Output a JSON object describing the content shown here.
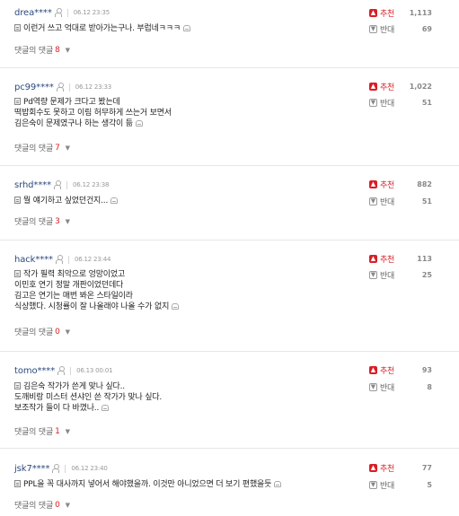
{
  "labels": {
    "up": "추천",
    "down": "반대",
    "replies": "댓글의 댓글"
  },
  "colors": {
    "accent": "#d81f26",
    "user": "#2e4a7d"
  },
  "icons": {
    "memo": "memo-icon",
    "report": "report-icon",
    "profile": "profile-icon",
    "up": "thumb-up-icon",
    "down": "thumb-down-icon",
    "chevron": "chevron-down-icon"
  },
  "comments": [
    {
      "user": "drea****",
      "time": "06.12 23:35",
      "lines": [
        "이런거 쓰고 억대로 받아가는구나. 부럽네ㅋㅋㅋ"
      ],
      "replies": "8",
      "up": "1,113",
      "down": "69"
    },
    {
      "user": "pc99****",
      "time": "06.12 23:33",
      "lines": [
        "Pd역량 문제가 크다고 봤는데",
        "떡밥회수도 못하고 이림 허무하게 쓰는거 보면서",
        "김은숙이 문제였구나 하는 생각이 듦"
      ],
      "replies": "7",
      "up": "1,022",
      "down": "51"
    },
    {
      "user": "srhd****",
      "time": "06.12 23:38",
      "lines": [
        "뭘 얘기하고 싶었던건지..."
      ],
      "replies": "3",
      "up": "882",
      "down": "51"
    },
    {
      "user": "hack****",
      "time": "06.12 23:44",
      "lines": [
        "작가 필력 최악으로 엉망이었고",
        "이민호 연기 정말 개판이었던데다",
        "김고은 연기는 매번 봐온 스타일이라",
        "식상했다. 시청률이 잘 나올래야 나올 수가 없지"
      ],
      "replies": "0",
      "up": "113",
      "down": "25"
    },
    {
      "user": "tomo****",
      "time": "06.13 00:01",
      "lines": [
        "김은숙 작가가 쓴게 맞나 싶다..",
        "도깨비랑 미스터 션샤인 쓴 작가가 맞나 싶다.",
        "보조작가 들이 다 바꼈나.."
      ],
      "replies": "1",
      "up": "93",
      "down": "8"
    },
    {
      "user": "jsk7****",
      "time": "06.12 23:40",
      "lines": [
        "PPL을 꼭 대사까지 넣어서 해야했을까. 이것만 아니었으면 더 보기 편했을듯"
      ],
      "replies": "0",
      "up": "77",
      "down": "5"
    }
  ]
}
